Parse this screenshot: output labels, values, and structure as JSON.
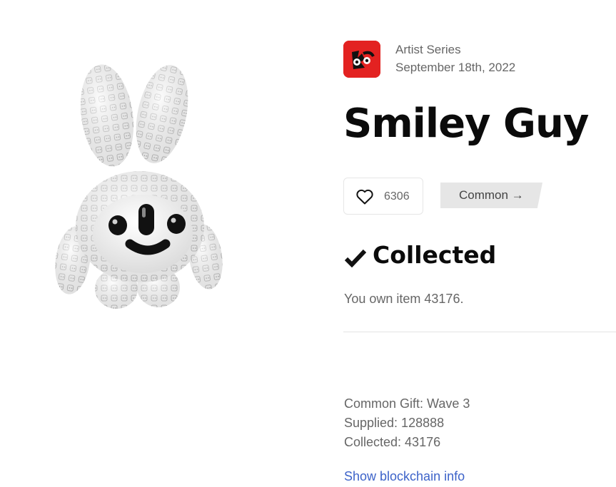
{
  "series": {
    "logo_icon": "series-logo-icon",
    "logo_color": "#e32221",
    "name": "Artist Series",
    "date": "September 18th, 2022"
  },
  "item": {
    "title": "Smiley Guy",
    "image_icon": "smiley-guy-figure"
  },
  "likes": {
    "icon": "heart-icon",
    "count": "6306"
  },
  "rarity": {
    "label": "Common →"
  },
  "collected": {
    "icon": "checkmark-icon",
    "heading": "Collected",
    "ownership_text": "You own item 43176."
  },
  "stats": {
    "gift": "Common Gift: Wave 3",
    "supplied": "Supplied: 128888",
    "collected": "Collected: 43176"
  },
  "link": {
    "label": "Show blockchain info",
    "color": "#3d63c9"
  }
}
